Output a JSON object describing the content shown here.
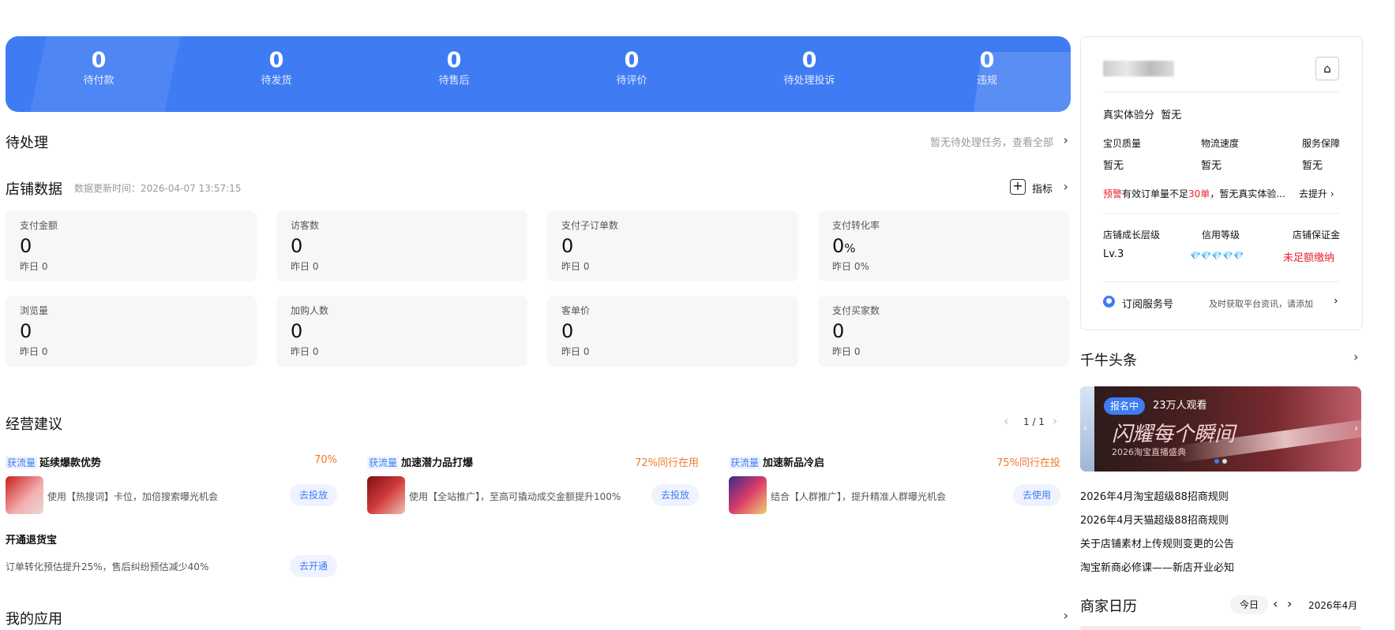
{
  "banner": {
    "stats": [
      {
        "value": "0",
        "label": "待付款"
      },
      {
        "value": "0",
        "label": "待发货"
      },
      {
        "value": "0",
        "label": "待售后"
      },
      {
        "value": "0",
        "label": "待评价"
      },
      {
        "value": "0",
        "label": "待处理投诉"
      },
      {
        "value": "0",
        "label": "违规"
      }
    ]
  },
  "pending": {
    "title": "待处理",
    "link": "暂无待处理任务，查看全部"
  },
  "shop_data": {
    "title": "店铺数据",
    "update_time": "数据更新时间：2026-04-07 13:57:15",
    "metric_btn": "指标",
    "cards": [
      {
        "title": "支付金额",
        "value": "0",
        "unit": "",
        "yesterday": "昨日 0"
      },
      {
        "title": "访客数",
        "value": "0",
        "unit": "",
        "yesterday": "昨日 0"
      },
      {
        "title": "支付子订单数",
        "value": "0",
        "unit": "",
        "yesterday": "昨日 0"
      },
      {
        "title": "支付转化率",
        "value": "0",
        "unit": "%",
        "yesterday": "昨日 0%"
      },
      {
        "title": "浏览量",
        "value": "0",
        "unit": "",
        "yesterday": "昨日 0"
      },
      {
        "title": "加购人数",
        "value": "0",
        "unit": "",
        "yesterday": "昨日 0"
      },
      {
        "title": "客单价",
        "value": "0",
        "unit": "",
        "yesterday": "昨日 0"
      },
      {
        "title": "支付买家数",
        "value": "0",
        "unit": "",
        "yesterday": "昨日 0"
      }
    ]
  },
  "suggestions": {
    "title": "经营建议",
    "pager": "1 / 1",
    "items": [
      {
        "tag": "获流量",
        "name": "延续爆款优势",
        "pct": "70%",
        "desc": "使用【热搜词】卡位，加倍搜索曝光机会",
        "btn": "去投放"
      },
      {
        "tag": "获流量",
        "name": "加速潜力品打爆",
        "pct": "72%同行在用",
        "desc": "使用【全站推广】，至高可撬动成交金额提升100%",
        "btn": "去投放"
      },
      {
        "tag": "获流量",
        "name": "加速新品冷启",
        "pct": "75%同行在投",
        "desc": "结合【人群推广】，提升精准人群曝光机会",
        "btn": "去使用"
      }
    ],
    "refund": {
      "name": "开通退货宝",
      "desc": "订单转化预估提升25%，售后纠纷预估减少40%",
      "btn": "去开通"
    }
  },
  "my_apps": {
    "title": "我的应用"
  },
  "shop_card": {
    "experience_label": "真实体验分",
    "experience_value": "暂无",
    "dims": [
      {
        "label": "宝贝质量",
        "value": "暂无"
      },
      {
        "label": "物流速度",
        "value": "暂无"
      },
      {
        "label": "服务保障",
        "value": "暂无"
      }
    ],
    "warn_tag": "预警",
    "warn_text_1": "有效订单量不足",
    "warn_num": "30单",
    "warn_text_2": "，暂无真实体验...",
    "warn_action": "去提升",
    "levels": [
      {
        "label": "店铺成长层级",
        "value": "Lv.3"
      },
      {
        "label": "信用等级",
        "value": "💎💎💎💎💎"
      },
      {
        "label": "店铺保证金",
        "value": "未足额缴纳"
      }
    ],
    "subscribe_label": "订阅服务号",
    "subscribe_hint": "及时获取平台资讯，请添加"
  },
  "headlines": {
    "title": "千牛头条",
    "banner_tag": "报名中",
    "banner_views": "23万人观看",
    "banner_slogan": "闪耀每个瞬间",
    "banner_sub": "2026淘宝直播盛典",
    "items": [
      "2026年4月淘宝超级88招商规则",
      "2026年4月天猫超级88招商规则",
      "关于店铺素材上传规则变更的公告",
      "淘宝新商必修课——新店开业必知"
    ]
  },
  "calendar": {
    "title": "商家日历",
    "today": "今日",
    "month": "2026年4月"
  },
  "colors": {
    "primary": "#3f7cf4",
    "warning": "#f07a2d",
    "danger": "#e8222d"
  }
}
